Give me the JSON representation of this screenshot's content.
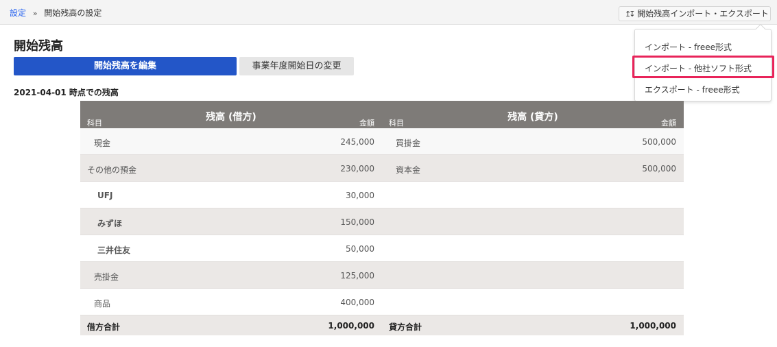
{
  "breadcrumb": {
    "parent": "設定",
    "separator": "»",
    "current": "開始残高の設定"
  },
  "header_actions": {
    "icon": "import-export-icon",
    "import_export_label": "開始残高インポート・エクスポート"
  },
  "dropdown": {
    "items": [
      {
        "label": "インポート - freee形式"
      },
      {
        "label": "インポート - 他社ソフト形式",
        "highlighted": true
      },
      {
        "label": "エクスポート - freee形式"
      }
    ],
    "highlight_color": "#e8245a"
  },
  "page": {
    "title": "開始残高",
    "edit_button": "開始残高を編集",
    "fiscal_year_button": "事業年度開始日の変更",
    "as_of": "2021-04-01 時点での残高"
  },
  "debit": {
    "title": "残高 (借方)",
    "subject_header": "科目",
    "amount_header": "金額",
    "rows": [
      {
        "name": "現金",
        "amount": "245,000"
      },
      {
        "name": "その他の預金",
        "amount": "230,000"
      },
      {
        "name": "UFJ",
        "amount": "30,000"
      },
      {
        "name": "みずほ",
        "amount": "150,000"
      },
      {
        "name": "三井住友",
        "amount": "50,000"
      },
      {
        "name": "売掛金",
        "amount": "125,000"
      },
      {
        "name": "商品",
        "amount": "400,000"
      }
    ],
    "total_label": "借方合計",
    "total_amount": "1,000,000"
  },
  "credit": {
    "title": "残高 (貸方)",
    "subject_header": "科目",
    "amount_header": "金額",
    "rows": [
      {
        "name": "買掛金",
        "amount": "500,000"
      },
      {
        "name": "資本金",
        "amount": "500,000"
      }
    ],
    "total_label": "貸方合計",
    "total_amount": "1,000,000"
  },
  "colors": {
    "primary_button": "#2356c8",
    "table_header": "#7e7b78",
    "link": "#2864f0"
  }
}
